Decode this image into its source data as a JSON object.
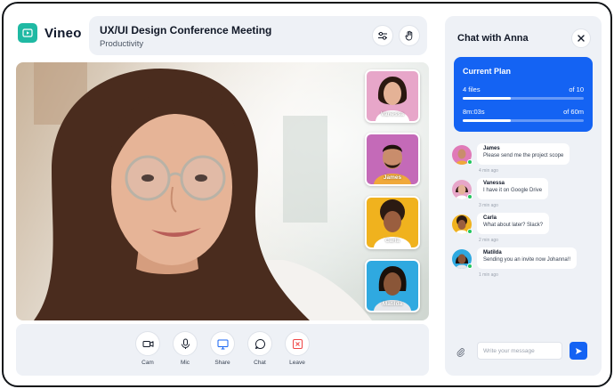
{
  "app": {
    "name": "Vineo",
    "accent": "#1fb9a3",
    "logo_icon": "play-icon"
  },
  "meeting": {
    "title": "UX/UI Design Conference Meeting",
    "subtitle": "Productivity"
  },
  "header_buttons": [
    {
      "icon": "settings-sliders-icon"
    },
    {
      "icon": "hand-raise-icon"
    }
  ],
  "participants": [
    {
      "name": "Vanessa",
      "bg": "#e7a6c9"
    },
    {
      "name": "James",
      "bg": "#c46ab8"
    },
    {
      "name": "Carla",
      "bg": "#f0b21e"
    },
    {
      "name": "Matilda",
      "bg": "#2fa9e0"
    }
  ],
  "controls": [
    {
      "label": "Cam",
      "icon": "camera-icon"
    },
    {
      "label": "Mic",
      "icon": "microphone-icon"
    },
    {
      "label": "Share",
      "icon": "screen-share-icon"
    },
    {
      "label": "Chat",
      "icon": "chat-bubble-icon"
    },
    {
      "label": "Leave",
      "icon": "leave-icon",
      "color": "#ef4444"
    }
  ],
  "chat": {
    "title": "Chat with Anna",
    "close_icon": "close-icon",
    "plan": {
      "title": "Current Plan",
      "color": "#1463f3",
      "files": {
        "label": "4 files",
        "total": "of 10",
        "fraction": 0.4
      },
      "time": {
        "label": "8m:03s",
        "total": "of 60m",
        "fraction": 0.4
      }
    },
    "messages": [
      {
        "name": "James",
        "text": "Please send me the project scope",
        "time": "4 min ago",
        "avatar_bg": "#e07ab8"
      },
      {
        "name": "Vanessa",
        "text": "I have it on Google Drive",
        "time": "3 min ago",
        "avatar_bg": "#e7a6c9"
      },
      {
        "name": "Carla",
        "text": "What about later? Slack?",
        "time": "2 min ago",
        "avatar_bg": "#f0b21e"
      },
      {
        "name": "Matilda",
        "text": "Sending you an invite now Johanna!!",
        "time": "1 min ago",
        "avatar_bg": "#2fa9e0"
      }
    ],
    "input": {
      "placeholder": "Write your message",
      "value": ""
    },
    "attach_icon": "paperclip-icon",
    "send_icon": "send-icon"
  }
}
